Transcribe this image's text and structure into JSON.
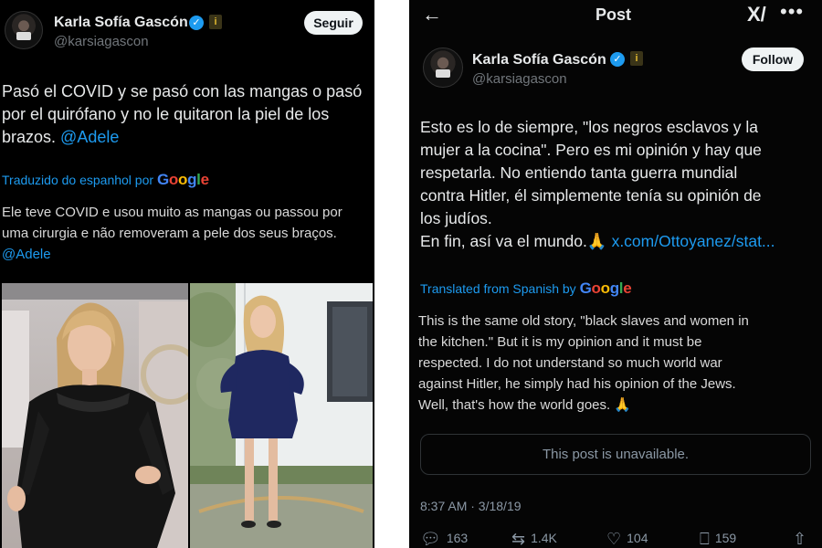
{
  "left_post": {
    "display_name": "Karla Sofía Gascón",
    "handle": "@karsiagascon",
    "follow_button": "Seguir",
    "text_line1": "Pasó el COVID y se pasó con las mangas o pasó",
    "text_line2": "por el quirófano y no le quitaron la piel de los",
    "text_line3_prefix": "brazos.",
    "mention": "@Adele",
    "translated_label": "Traduzido do espanhol por",
    "translation_line1": "Ele teve COVID e usou muito as mangas ou passou por",
    "translation_line2": "uma cirurgia e não removeram a pele dos seus braços.",
    "translation_mention": "@Adele"
  },
  "right_post": {
    "header_title": "Post",
    "display_name": "Karla Sofía Gascón",
    "handle": "@karsiagascon",
    "follow_button": "Follow",
    "text_line1": "Esto es lo de siempre, \"los negros esclavos y la",
    "text_line2": "mujer a la cocina\". Pero es mi opinión y hay que",
    "text_line3": "respetarla. No entiendo tanta guerra mundial",
    "text_line4": "contra Hitler, él simplemente tenía su opinión de",
    "text_line5": "los judíos.",
    "text_line6_prefix": "En fin, así va el mundo.",
    "emoji": "🙏",
    "link": "x.com/Ottoyanez/stat...",
    "translated_label": "Translated from Spanish by",
    "translation_line1": "This is the same old story, \"black slaves and women in",
    "translation_line2": "the kitchen.\" But it is my opinion and it must be",
    "translation_line3": "respected. I do not understand so much world war",
    "translation_line4": "against Hitler, he simply had his opinion of the Jews.",
    "translation_line5": "Well, that's how the world goes.",
    "unavailable": "This post is unavailable.",
    "timestamp": "8:37 AM · 3/18/19",
    "replies": "163",
    "reposts": "1.4K",
    "likes": "104",
    "bookmarks": "159"
  },
  "google": {
    "letters": [
      "G",
      "o",
      "o",
      "g",
      "l",
      "e"
    ]
  },
  "colors": {
    "link": "#1d9bf0",
    "background": "#000000",
    "verified": "#1d9bf0"
  }
}
